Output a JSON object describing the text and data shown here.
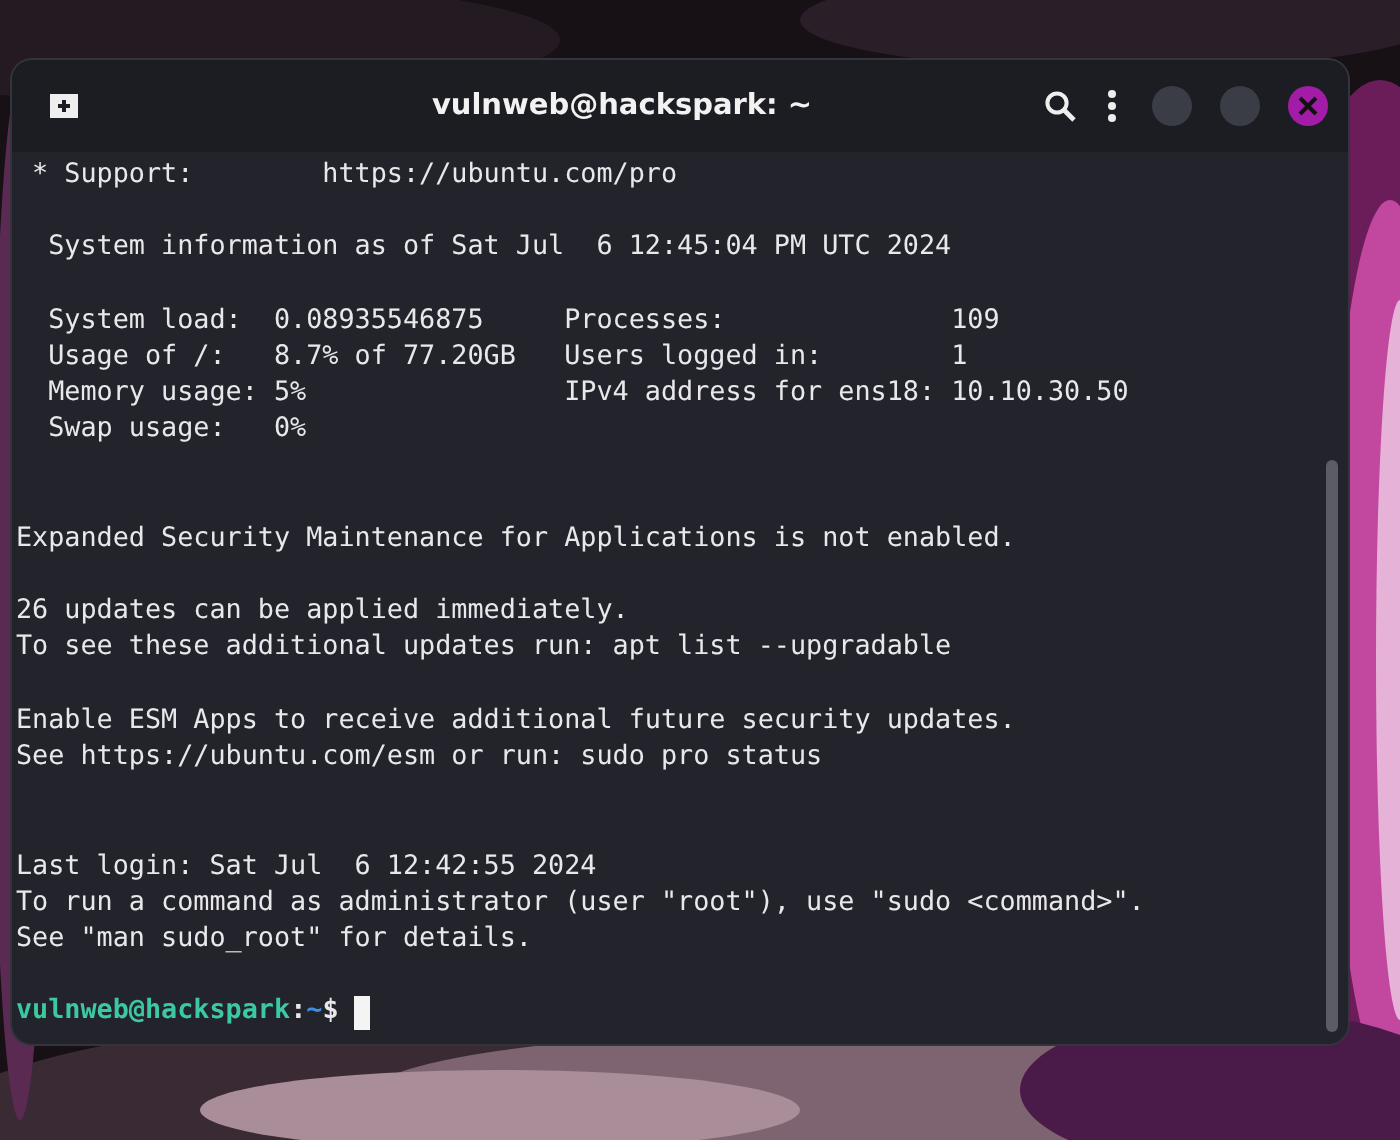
{
  "window": {
    "title": "vulnweb@hackspark: ~"
  },
  "terminal": {
    "lines": [
      {
        "kind": "output",
        "text": " * Support:        https://ubuntu.com/pro"
      },
      {
        "kind": "blank"
      },
      {
        "kind": "output",
        "text": "  System information as of Sat Jul  6 12:45:04 PM UTC 2024"
      },
      {
        "kind": "blank"
      },
      {
        "kind": "output",
        "text": "  System load:  0.08935546875     Processes:              109"
      },
      {
        "kind": "output",
        "text": "  Usage of /:   8.7% of 77.20GB   Users logged in:        1"
      },
      {
        "kind": "output",
        "text": "  Memory usage: 5%                IPv4 address for ens18: 10.10.30.50"
      },
      {
        "kind": "output",
        "text": "  Swap usage:   0%"
      },
      {
        "kind": "blank"
      },
      {
        "kind": "blank"
      },
      {
        "kind": "output",
        "text": "Expanded Security Maintenance for Applications is not enabled."
      },
      {
        "kind": "blank"
      },
      {
        "kind": "output",
        "text": "26 updates can be applied immediately."
      },
      {
        "kind": "output",
        "text": "To see these additional updates run: apt list --upgradable"
      },
      {
        "kind": "blank"
      },
      {
        "kind": "output",
        "text": "Enable ESM Apps to receive additional future security updates."
      },
      {
        "kind": "output",
        "text": "See https://ubuntu.com/esm or run: sudo pro status"
      },
      {
        "kind": "blank"
      },
      {
        "kind": "blank"
      },
      {
        "kind": "output",
        "text": "Last login: Sat Jul  6 12:42:55 2024"
      },
      {
        "kind": "output",
        "text": "To run a command as administrator (user \"root\"), use \"sudo <command>\"."
      },
      {
        "kind": "output",
        "text": "See \"man sudo_root\" for details."
      },
      {
        "kind": "blank"
      }
    ],
    "prompt": {
      "user_host": "vulnweb@hackspark",
      "separator": ":",
      "path": "~",
      "symbol": "$"
    }
  }
}
